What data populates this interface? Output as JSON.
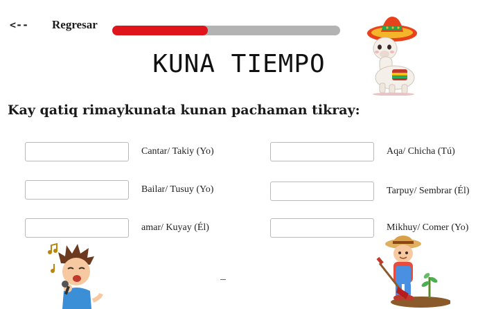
{
  "header": {
    "back_glyph": "<--",
    "back_label": "Regresar",
    "progress": 0.42
  },
  "title": "KUNA TIEMPO",
  "instruction": "Kay qatiq rimaykunata kunan pachaman tikray:",
  "exercises": [
    {
      "label": "Cantar/ Takiy (Yo)",
      "value": ""
    },
    {
      "label": "Aqa/ Chicha (Tú)",
      "value": ""
    },
    {
      "label": "Bailar/  Tusuy (Yo)",
      "value": ""
    },
    {
      "label": "Tarpuy/ Sembrar (Él)",
      "value": ""
    },
    {
      "label": "amar/  Kuyay (Él)",
      "value": ""
    },
    {
      "label": "Mikhuy/ Comer (Yo)",
      "value": ""
    }
  ],
  "colors": {
    "progress_fill": "#e0141b",
    "progress_track": "#b3b3b3"
  },
  "illustrations": [
    "llama-with-sombrero",
    "singing-boy",
    "gardening-boy"
  ]
}
